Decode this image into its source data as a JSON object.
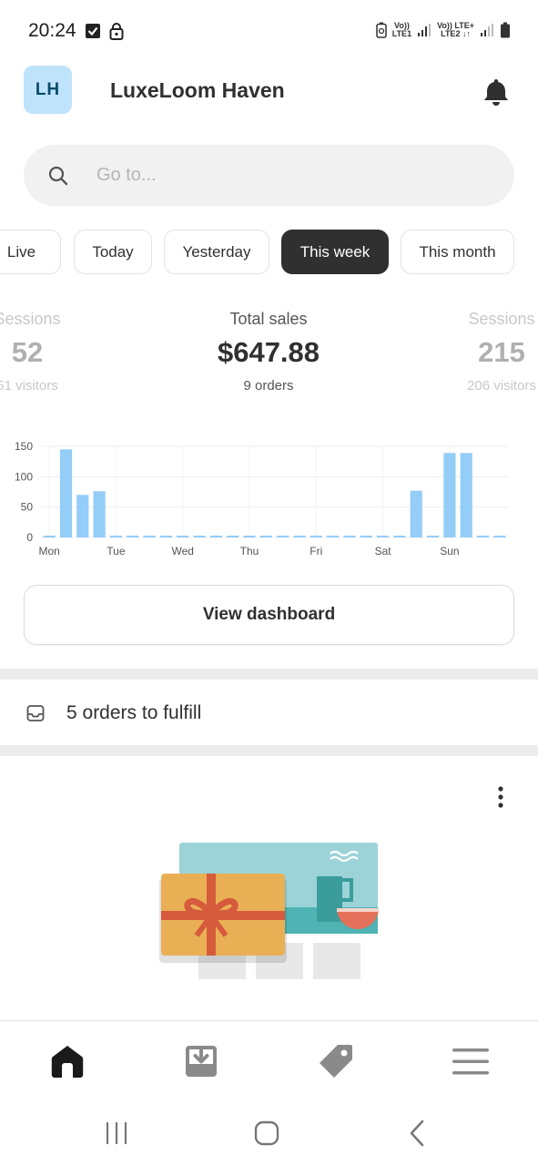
{
  "status_bar": {
    "time": "20:24",
    "sim1_label_top": "Vo))",
    "sim1_label_bottom": "LTE1",
    "sim2_label_top": "Vo)) LTE+",
    "sim2_label_bottom": "LTE2 ↓↑"
  },
  "header": {
    "avatar_initials": "LH",
    "store_name": "LuxeLoom Haven"
  },
  "search": {
    "placeholder": "Go to..."
  },
  "date_filters": [
    {
      "label": "Live",
      "active": false
    },
    {
      "label": "Today",
      "active": false
    },
    {
      "label": "Yesterday",
      "active": false
    },
    {
      "label": "This week",
      "active": true
    },
    {
      "label": "This month",
      "active": false
    }
  ],
  "metrics": [
    {
      "label": "Sessions",
      "value": "52",
      "sub": "51 visitors"
    },
    {
      "label": "Total sales",
      "value": "$647.88",
      "sub": "9 orders"
    },
    {
      "label": "Sessions",
      "value": "215",
      "sub": "206 visitors"
    }
  ],
  "chart_data": {
    "type": "bar",
    "categories": [
      "Mon",
      "",
      "",
      "",
      "Tue",
      "",
      "",
      "",
      "Wed",
      "",
      "",
      "",
      "Thu",
      "",
      "",
      "",
      "Fri",
      "",
      "",
      "",
      "Sat",
      "",
      "",
      "",
      "Sun",
      "",
      "",
      ""
    ],
    "x_tick_labels": [
      "Mon",
      "Tue",
      "Wed",
      "Thu",
      "Fri",
      "Sat",
      "Sun"
    ],
    "values": [
      0,
      145,
      70,
      76,
      0,
      0,
      0,
      0,
      0,
      0,
      0,
      0,
      0,
      0,
      0,
      0,
      0,
      0,
      0,
      0,
      0,
      0,
      77,
      0,
      139,
      139,
      0,
      0
    ],
    "ylim": [
      0,
      150
    ],
    "y_ticks": [
      0,
      50,
      100,
      150
    ],
    "grid": true,
    "bar_color": "#94cdf7"
  },
  "dashboard_button": {
    "label": "View dashboard"
  },
  "fulfill": {
    "text": "5 orders to fulfill",
    "icon": "inbox-icon"
  },
  "promo_card": {
    "menu_icon": "more-vertical-icon",
    "illustration": "gift-card-illustration"
  },
  "bottom_nav": [
    {
      "name": "home",
      "icon": "home-icon",
      "active": true
    },
    {
      "name": "orders",
      "icon": "orders-icon",
      "active": false
    },
    {
      "name": "products",
      "icon": "tag-icon",
      "active": false
    },
    {
      "name": "menu",
      "icon": "hamburger-menu-icon",
      "active": false
    }
  ],
  "colors": {
    "accent_dark": "#303030",
    "avatar_bg": "#bfe3fa",
    "chart_bar": "#94cdf7"
  }
}
